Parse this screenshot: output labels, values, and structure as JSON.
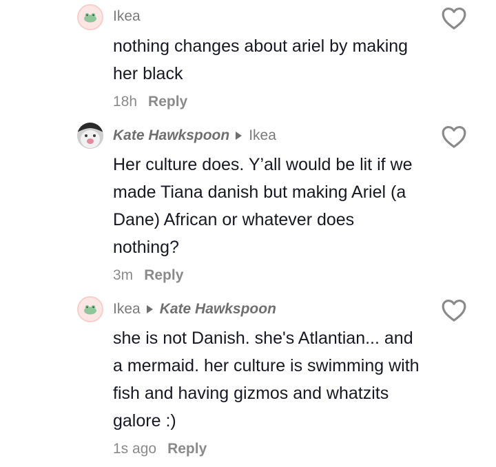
{
  "comments": [
    {
      "author": "Ikea",
      "reply_to": "",
      "text": "nothing changes about ariel by making her black",
      "time": "18h",
      "reply_label": "Reply",
      "avatar_icon": "frog-avatar-icon"
    },
    {
      "author": "Kate Hawkspoon",
      "reply_to": "Ikea",
      "text": "Her culture does. Y’all would be lit if we made Tiana danish but making Ariel (a Dane) African or whatever does nothing?",
      "time": "3m",
      "reply_label": "Reply",
      "avatar_icon": "cat-avatar-icon"
    },
    {
      "author": "Ikea",
      "reply_to": "Kate Hawkspoon",
      "text": "she is not Danish. she's Atlantian... and a mermaid. her culture is swimming with fish and having gizmos and whatzits galore :)",
      "time": "1s ago",
      "reply_label": "Reply",
      "avatar_icon": "frog-avatar-icon"
    }
  ],
  "icons": {
    "like": "heart-outline-icon"
  },
  "colors": {
    "text": "#161823",
    "secondary": "#8a8a8a",
    "avatar_bg": "#fbe6e4"
  }
}
